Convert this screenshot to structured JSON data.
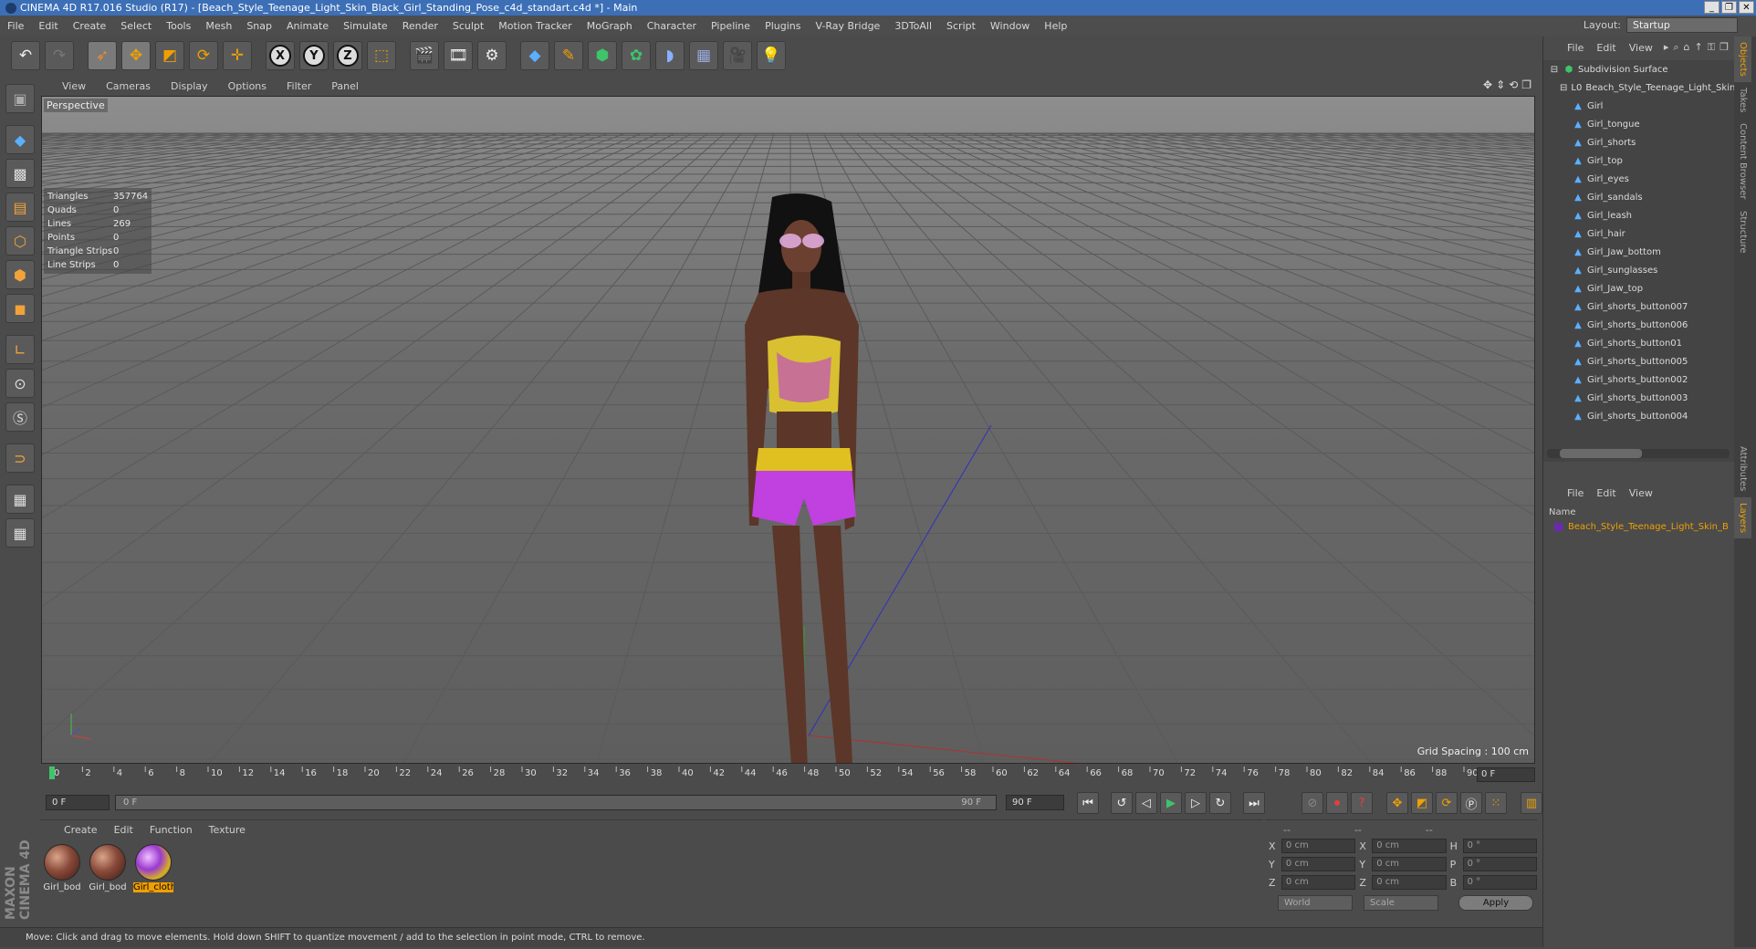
{
  "window": {
    "title": "CINEMA 4D R17.016 Studio (R17) - [Beach_Style_Teenage_Light_Skin_Black_Girl_Standing_Pose_c4d_standart.c4d *] - Main"
  },
  "menu": [
    "File",
    "Edit",
    "Create",
    "Select",
    "Tools",
    "Mesh",
    "Snap",
    "Animate",
    "Simulate",
    "Render",
    "Sculpt",
    "Motion Tracker",
    "MoGraph",
    "Character",
    "Pipeline",
    "Plugins",
    "V-Ray Bridge",
    "3DToAll",
    "Script",
    "Window",
    "Help"
  ],
  "layout": {
    "label": "Layout:",
    "value": "Startup"
  },
  "viewport": {
    "menu": [
      "View",
      "Cameras",
      "Display",
      "Options",
      "Filter",
      "Panel"
    ],
    "label": "Perspective",
    "stats": [
      {
        "k": "Triangles",
        "v": "357764"
      },
      {
        "k": "Quads",
        "v": "0"
      },
      {
        "k": "Lines",
        "v": "269"
      },
      {
        "k": "Points",
        "v": "0"
      },
      {
        "k": "Triangle Strips",
        "v": "0"
      },
      {
        "k": "Line Strips",
        "v": "0"
      }
    ],
    "grid_spacing": "Grid Spacing : 100 cm"
  },
  "timeline": {
    "ticks": [
      "0",
      "2",
      "4",
      "6",
      "8",
      "10",
      "12",
      "14",
      "16",
      "18",
      "20",
      "22",
      "24",
      "26",
      "28",
      "30",
      "32",
      "34",
      "36",
      "38",
      "40",
      "42",
      "44",
      "46",
      "48",
      "50",
      "52",
      "54",
      "56",
      "58",
      "60",
      "62",
      "64",
      "66",
      "68",
      "70",
      "72",
      "74",
      "76",
      "78",
      "80",
      "82",
      "84",
      "86",
      "88",
      "90"
    ],
    "current_frame": "0 F"
  },
  "transport": {
    "start": "0 F",
    "slider_start": "0 F",
    "slider_end": "90 F",
    "end": "90 F"
  },
  "material_manager": {
    "menu": [
      "Create",
      "Edit",
      "Function",
      "Texture"
    ],
    "materials": [
      {
        "label": "Girl_bod",
        "selected": false
      },
      {
        "label": "Girl_bod",
        "selected": false
      },
      {
        "label": "Girl_cloth",
        "selected": true
      }
    ]
  },
  "coordinates": {
    "headers": [
      "--",
      "--",
      "--"
    ],
    "rows": [
      {
        "a1": "X",
        "v1": "0 cm",
        "a2": "X",
        "v2": "0 cm",
        "a3": "H",
        "v3": "0 °"
      },
      {
        "a1": "Y",
        "v1": "0 cm",
        "a2": "Y",
        "v2": "0 cm",
        "a3": "P",
        "v3": "0 °"
      },
      {
        "a1": "Z",
        "v1": "0 cm",
        "a2": "Z",
        "v2": "0 cm",
        "a3": "B",
        "v3": "0 °"
      }
    ],
    "world": "World",
    "scale": "Scale",
    "apply": "Apply"
  },
  "status": "Move: Click and drag to move elements. Hold down SHIFT to quantize movement / add to the selection in point mode, CTRL to remove.",
  "object_manager": {
    "menu": [
      "File",
      "Edit",
      "View"
    ],
    "root": "Subdivision Surface",
    "group": "Beach_Style_Teenage_Light_Skin_",
    "children": [
      "Girl",
      "Girl_tongue",
      "Girl_shorts",
      "Girl_top",
      "Girl_eyes",
      "Girl_sandals",
      "Girl_leash",
      "Girl_hair",
      "Girl_Jaw_bottom",
      "Girl_sunglasses",
      "Girl_Jaw_top",
      "Girl_shorts_button007",
      "Girl_shorts_button006",
      "Girl_shorts_button01",
      "Girl_shorts_button005",
      "Girl_shorts_button002",
      "Girl_shorts_button003",
      "Girl_shorts_button004"
    ]
  },
  "layer_manager": {
    "menu": [
      "File",
      "Edit",
      "View"
    ],
    "name_header": "Name",
    "layer": "Beach_Style_Teenage_Light_Skin_B"
  },
  "side_tabs": [
    "Objects",
    "Takes",
    "Content Browser",
    "Structure",
    "Attributes",
    "Layers"
  ],
  "maxon_logo": "MAXON CINEMA 4D",
  "colors": {
    "accent": "#f0a000",
    "title_bar": "#3c6fb6"
  }
}
